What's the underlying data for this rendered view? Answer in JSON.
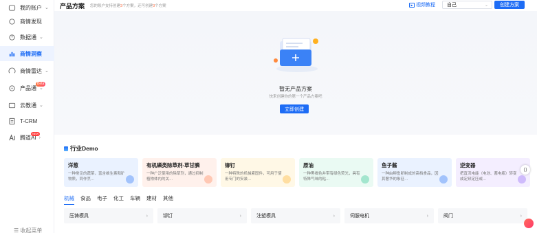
{
  "sidebar": {
    "items": [
      {
        "label": "我的账户",
        "icon": "account-icon",
        "chevron": "⌄"
      },
      {
        "label": "商情发现",
        "icon": "discover-icon",
        "chevron": ""
      },
      {
        "label": "数据通",
        "icon": "data-icon",
        "chevron": "⌄"
      },
      {
        "label": "商情洞察",
        "icon": "insight-icon",
        "chevron": ""
      },
      {
        "label": "商情雷达",
        "icon": "radar-icon",
        "chevron": "⌄"
      },
      {
        "label": "产品通",
        "icon": "product-icon",
        "chevron": "⌄",
        "badge": "Beta"
      },
      {
        "label": "云教通",
        "icon": "cloud-icon",
        "chevron": "⌄"
      },
      {
        "label": "T-CRM",
        "icon": "crm-icon",
        "chevron": ""
      },
      {
        "label": "腾道AI",
        "icon": "ai-icon",
        "chevron": "›",
        "badge": "NEW"
      }
    ],
    "collapse_label": "收起菜单"
  },
  "header": {
    "title": "产品方案",
    "subtitle_prefix": "您的账户支持创建",
    "subtitle_n1": "3",
    "subtitle_mid": "个方案，还可创建",
    "subtitle_n2": "3",
    "subtitle_suffix": "个方案",
    "video_label": "视频教程",
    "owner_value": "自己",
    "create_label": "创建方案"
  },
  "empty": {
    "title": "暂无产品方案",
    "desc": "快来创建你的第一个产品方案吧",
    "button": "立即创建"
  },
  "demo": {
    "title": "行业Demo",
    "cards": [
      {
        "name": "洋葱",
        "desc": "一种常见的蔬菜，富含维生素和矿物质，同作烹…",
        "color": "#eaf2ff",
        "deco": "#1d6cf5"
      },
      {
        "name": "有机磷类除草剂-草甘膦",
        "desc": "一种广泛使用的除草剂，通过抑制植物体内的关…",
        "color": "#fff1ec",
        "deco": "#ff7a4d"
      },
      {
        "name": "铆钉",
        "desc": "一种特殊的机械紧固件，可用于使用专门的安装…",
        "color": "#fff8e6",
        "deco": "#ffb020"
      },
      {
        "name": "原油",
        "desc": "一种黑褐色并带有绿色荧光，具有特殊气味的粘…",
        "color": "#eafaf3",
        "deco": "#20c08a"
      },
      {
        "name": "鱼子酱",
        "desc": "一种由鲟鱼卵制成的高档食品，因其奢华的象征…",
        "color": "#eaf2ff",
        "deco": "#1d6cf5"
      },
      {
        "name": "逆变器",
        "desc": "把直流电能（电池、蓄电瓶）转变成定频定压或…",
        "color": "#f4eeff",
        "deco": "#8a5cf5"
      }
    ],
    "tabs": [
      "机械",
      "食品",
      "电子",
      "化工",
      "车辆",
      "建材",
      "其他"
    ],
    "rows": [
      "压铸模具",
      "铆钉",
      "注塑模具",
      "伺服电机",
      "阀门"
    ]
  }
}
